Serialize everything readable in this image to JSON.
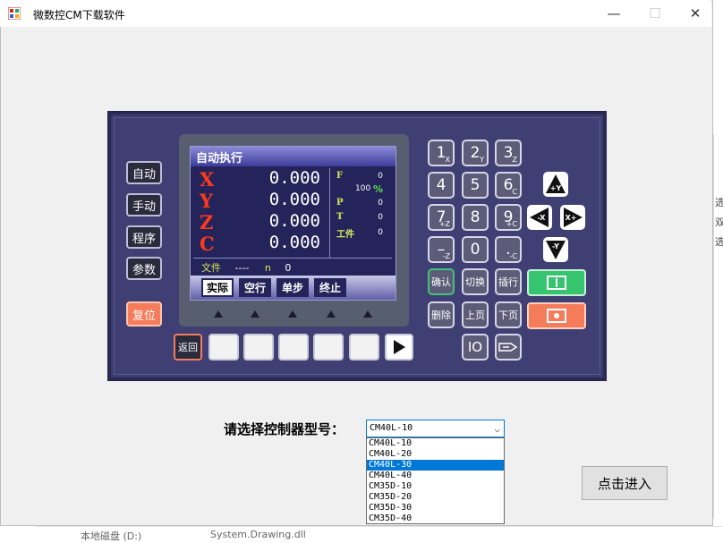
{
  "window": {
    "title": "微数控CM下载软件",
    "controls": {
      "minimize": "—",
      "maximize": "☐",
      "close": "✕"
    }
  },
  "background_window": {
    "fragments": [
      "选",
      "双",
      "选"
    ],
    "bottom_text": "本地磁盘 (D:)",
    "bottom_file": "System.Drawing.dll"
  },
  "controller": {
    "side_buttons": [
      "自动",
      "手动",
      "程序",
      "参数"
    ],
    "reset_button": "复位",
    "screen": {
      "title": "自动执行",
      "axes": [
        {
          "name": "X",
          "value": "0.000"
        },
        {
          "name": "Y",
          "value": "0.000"
        },
        {
          "name": "Z",
          "value": "0.000"
        },
        {
          "name": "C",
          "value": "0.000"
        }
      ],
      "stats": {
        "f_label": "F",
        "f_value": "0",
        "percent_value": "100",
        "percent_unit": "%",
        "p_label": "P",
        "p_value": "0",
        "t_label": "T",
        "t_value": "0",
        "job_label": "工件",
        "job_value": "0"
      },
      "file_row": {
        "label": "文件",
        "value": "----",
        "n_label": "n",
        "n_value": "0"
      },
      "softkeys": [
        "实际",
        "空行",
        "单步",
        "终止"
      ]
    },
    "back_button": "返回",
    "keypad": [
      {
        "main": "1",
        "sub": "X"
      },
      {
        "main": "2",
        "sub": "Y"
      },
      {
        "main": "3",
        "sub": "Z"
      },
      {
        "main": "4",
        "sub": ""
      },
      {
        "main": "5",
        "sub": ""
      },
      {
        "main": "6",
        "sub": "C"
      },
      {
        "main": "7",
        "sub": "+Z"
      },
      {
        "main": "8",
        "sub": ""
      },
      {
        "main": "9",
        "sub": "+C"
      },
      {
        "main": "–",
        "sub": "-Z"
      },
      {
        "main": "0",
        "sub": ""
      },
      {
        "main": ".",
        "sub": "-C"
      }
    ],
    "function_keys": [
      "确认",
      "切换",
      "插行",
      "删除",
      "上页",
      "下页"
    ],
    "io_key": "IO",
    "jog": {
      "up": "+Y",
      "left": "-X",
      "right": "X+",
      "down": "-Y"
    }
  },
  "form": {
    "select_label": "请选择控制器型号：",
    "selected_value": "CM40L-10",
    "options": [
      "CM40L-10",
      "CM40L-20",
      "CM40L-30",
      "CM40L-40",
      "CM35D-10",
      "CM35D-20",
      "CM35D-30",
      "CM35D-40"
    ],
    "highlighted_index": 2,
    "enter_button": "点击进入"
  }
}
